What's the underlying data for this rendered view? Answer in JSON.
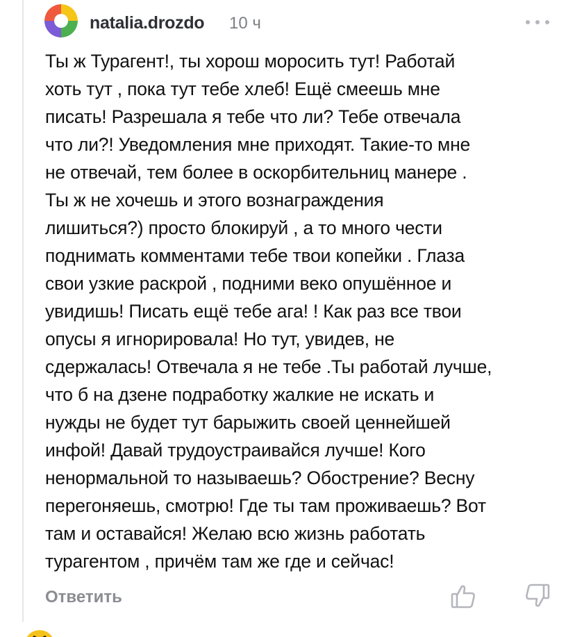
{
  "comment": {
    "author": "natalia.drozdo",
    "time": "10 ч",
    "text": "Ты ж Турагент!, ты хорош моросить тут! Работай\nхоть  тут , пока тут тебе  хлеб! Ещё смеешь мне\nписать! Разрешала я тебе  что ли? Тебе  отвечала\nчто ли?! Уведомления мне приходят. Такие-то мне\nне отвечай, тем более в оскорбительниц манере .\nТы ж не хочешь и этого вознаграждения\nлишиться?) просто блокируй , а то много чести\nподнимать комментами тебе твои копейки . Глаза\nсвои узкие раскрой , подними веко опушённое и\nувидишь! Писать ещё тебе ага! ! Как раз все твои\nопусы я игнорировала! Но тут, увидев, не\nсдержалась! Отвечала я не тебе .Ты работай лучше,\nчто б на дзене подработку жалкие не искать и\nнужды не будет тут барыжить своей ценнейшей\nинфой! Давай трудоустраивайся лучше! Кого\nненормальной то называешь? Обострение? Весну\nперегоняешь, смотрю! Где ты там проживаешь? Вот\nтам и оставайся! Желаю всю жизнь работать\nтурагентом , причём там же где и сейчас!",
    "reply_label": "Ответить"
  },
  "icons": {
    "avatar": "avatar-multicolor-icon",
    "more": "more-dots-icon",
    "like": "thumb-up-icon",
    "dislike": "thumb-down-icon"
  },
  "colors": {
    "author": "#2f3036",
    "meta": "#7d7f86",
    "text": "#111111",
    "reply": "#8b8d93",
    "icon": "#b4b6bc"
  }
}
